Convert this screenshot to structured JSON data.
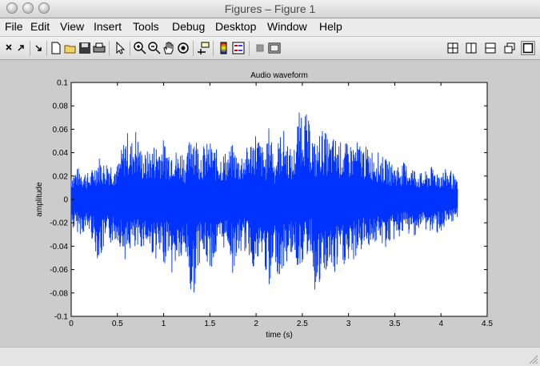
{
  "window": {
    "title": "Figures – Figure 1"
  },
  "menu": [
    "File",
    "Edit",
    "View",
    "Insert",
    "Tools",
    "Debug",
    "Desktop",
    "Window",
    "Help"
  ],
  "toolbar": {
    "left_icons": [
      "close-icon",
      "undock-icon",
      "dock-icon",
      "new-figure-icon",
      "open-file-icon",
      "save-icon",
      "print-icon",
      "edit-plot-icon",
      "zoom-in-icon",
      "zoom-out-icon",
      "pan-icon",
      "rotate-3d-icon",
      "data-cursor-icon",
      "colorbar-icon",
      "legend-icon",
      "hide-plot-tools-icon",
      "show-plot-tools-icon"
    ],
    "right_icons": [
      "tile-layout-icon",
      "left-right-layout-icon",
      "top-bottom-layout-icon",
      "float-icon",
      "maximize-icon"
    ]
  },
  "chart_data": {
    "type": "line",
    "title": "Audio waveform",
    "xlabel": "time (s)",
    "ylabel": "amplitude",
    "xlim": [
      0,
      4.5
    ],
    "ylim": [
      -0.1,
      0.1
    ],
    "xticks": [
      "0",
      "0.5",
      "1",
      "1.5",
      "2",
      "2.5",
      "3",
      "3.5",
      "4",
      "4.5"
    ],
    "yticks": [
      "0.1",
      "0.08",
      "0.06",
      "0.04",
      "0.02",
      "0",
      "-0.02",
      "-0.04",
      "-0.06",
      "-0.08",
      "-0.1"
    ],
    "grid": false,
    "color": "#0033ff",
    "series": [
      {
        "values_note_free": true,
        "x": [
          0,
          0.1,
          0.2,
          0.3,
          0.35,
          0.4,
          0.5,
          0.6,
          0.65,
          0.7,
          0.75,
          0.8,
          0.9,
          1.0,
          1.05,
          1.1,
          1.15,
          1.2,
          1.25,
          1.3,
          1.35,
          1.4,
          1.5,
          1.55,
          1.6,
          1.7,
          1.75,
          1.8,
          1.9,
          2.0,
          2.05,
          2.1,
          2.15,
          2.2,
          2.25,
          2.3,
          2.4,
          2.45,
          2.5,
          2.55,
          2.6,
          2.65,
          2.7,
          2.75,
          2.8,
          2.85,
          2.9,
          3.0,
          3.1,
          3.2,
          3.3,
          3.4,
          3.5,
          3.6,
          3.7,
          3.8,
          3.9,
          4.0,
          4.1,
          4.18
        ],
        "upper": [
          0.025,
          0.028,
          0.022,
          0.038,
          0.032,
          0.035,
          0.03,
          0.06,
          0.05,
          0.062,
          0.045,
          0.04,
          0.048,
          0.052,
          0.045,
          0.05,
          0.04,
          0.045,
          0.035,
          0.068,
          0.055,
          0.045,
          0.05,
          0.045,
          0.04,
          0.042,
          0.048,
          0.038,
          0.045,
          0.06,
          0.05,
          0.04,
          0.07,
          0.035,
          0.055,
          0.06,
          0.038,
          0.07,
          0.085,
          0.072,
          0.06,
          0.045,
          0.062,
          0.058,
          0.05,
          0.055,
          0.05,
          0.048,
          0.05,
          0.045,
          0.042,
          0.035,
          0.03,
          0.032,
          0.028,
          0.022,
          0.028,
          0.025,
          0.027,
          0.015
        ],
        "lower": [
          -0.025,
          -0.03,
          -0.028,
          -0.055,
          -0.045,
          -0.04,
          -0.035,
          -0.055,
          -0.04,
          -0.05,
          -0.042,
          -0.04,
          -0.05,
          -0.058,
          -0.045,
          -0.07,
          -0.05,
          -0.06,
          -0.05,
          -0.095,
          -0.07,
          -0.05,
          -0.06,
          -0.055,
          -0.045,
          -0.04,
          -0.065,
          -0.048,
          -0.045,
          -0.065,
          -0.05,
          -0.06,
          -0.092,
          -0.05,
          -0.07,
          -0.06,
          -0.045,
          -0.06,
          -0.055,
          -0.05,
          -0.045,
          -0.092,
          -0.075,
          -0.065,
          -0.06,
          -0.07,
          -0.055,
          -0.06,
          -0.048,
          -0.04,
          -0.038,
          -0.042,
          -0.035,
          -0.03,
          -0.032,
          -0.025,
          -0.03,
          -0.028,
          -0.025,
          -0.015
        ]
      }
    ]
  }
}
